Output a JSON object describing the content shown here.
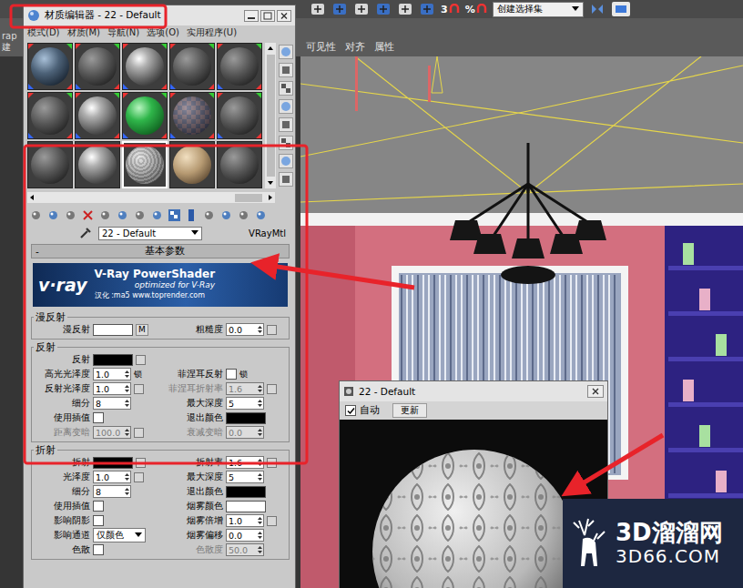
{
  "toolbar": {
    "labels": [
      "3",
      "%"
    ],
    "selection_set": "创建选择集"
  },
  "left_edge": [
    "rap",
    "建"
  ],
  "ribbon_tabs": [
    {
      "label": "可见性",
      "selected": false
    },
    {
      "label": "对齐",
      "selected": false
    },
    {
      "label": "属性",
      "selected": false
    }
  ],
  "material_editor": {
    "title": "材质编辑器 - 22 - Default",
    "menu": [
      "模式(D)",
      "材质(M)",
      "导航(N)",
      "选项(O)",
      "实用程序(U)"
    ],
    "slots": [
      {
        "kind": "glass",
        "selected": false,
        "assigned": true
      },
      {
        "kind": "plain",
        "selected": false,
        "assigned": true
      },
      {
        "kind": "shiny",
        "selected": false,
        "assigned": true
      },
      {
        "kind": "plain",
        "selected": false,
        "assigned": true
      },
      {
        "kind": "plain",
        "selected": false,
        "assigned": true
      },
      {
        "kind": "plain",
        "selected": false,
        "assigned": true
      },
      {
        "kind": "shiny",
        "selected": false,
        "assigned": true
      },
      {
        "kind": "green",
        "selected": false,
        "assigned": true
      },
      {
        "kind": "checker",
        "selected": false,
        "assigned": true
      },
      {
        "kind": "plain",
        "selected": false,
        "assigned": true
      },
      {
        "kind": "plain",
        "selected": false,
        "assigned": false
      },
      {
        "kind": "shiny",
        "selected": false,
        "assigned": false
      },
      {
        "kind": "stone",
        "selected": true,
        "assigned": false
      },
      {
        "kind": "sand",
        "selected": false,
        "assigned": false
      },
      {
        "kind": "plain",
        "selected": false,
        "assigned": false
      }
    ],
    "material_name": "22 - Default",
    "material_type": "VRayMtl",
    "rollout": {
      "title": "基本参数",
      "collapse": "-"
    },
    "banner": {
      "logo": "v·ray",
      "title": "V-Ray PowerShader",
      "subtitle": "optimized for V-Ray",
      "credit": "汉化 :ma5 www.toprender.com"
    },
    "groups": [
      {
        "title": "漫反射",
        "rows": [
          [
            {
              "kind": "swatch",
              "label": "漫反射",
              "color": "#ffffff",
              "map": "M",
              "disabled": false
            },
            {
              "kind": "spinner",
              "label": "粗糙度",
              "value": "0.0",
              "map_slot": true,
              "disabled": false
            }
          ]
        ]
      },
      {
        "title": "反射",
        "rows": [
          [
            {
              "kind": "swatch",
              "label": "反射",
              "color": "#000000",
              "map_slot": true,
              "disabled": false
            }
          ],
          [
            {
              "kind": "spinner",
              "label": "高光光泽度",
              "value": "1.0",
              "lock": "锁",
              "disabled": false
            },
            {
              "kind": "checkbox",
              "label": "菲涅耳反射",
              "checked": false,
              "lock": "锁",
              "disabled": false
            }
          ],
          [
            {
              "kind": "spinner",
              "label": "反射光泽度",
              "value": "1.0",
              "map_slot": true,
              "disabled": false
            },
            {
              "kind": "spinner",
              "label": "菲涅耳折射率",
              "value": "1.6",
              "map_slot": true,
              "disabled": true
            }
          ],
          [
            {
              "kind": "spinner",
              "label": "细分",
              "value": "8",
              "disabled": false
            },
            {
              "kind": "spinner",
              "label": "最大深度",
              "value": "5",
              "disabled": false
            }
          ],
          [
            {
              "kind": "checkbox",
              "label": "使用插值",
              "checked": false,
              "disabled": false
            },
            {
              "kind": "swatch",
              "label": "退出颜色",
              "color": "#000000",
              "disabled": false
            }
          ],
          [
            {
              "kind": "spinner",
              "label": "距离变暗",
              "value": "100.0",
              "map_slot": true,
              "disabled": true
            },
            {
              "kind": "spinner",
              "label": "衰减变暗",
              "value": "0.0",
              "disabled": true
            }
          ]
        ]
      },
      {
        "title": "折射",
        "rows": [
          [
            {
              "kind": "swatch",
              "label": "折射",
              "color": "#000000",
              "map_slot": true,
              "disabled": false
            },
            {
              "kind": "spinner",
              "label": "折射率",
              "value": "1.6",
              "map_slot": true,
              "disabled": false
            }
          ],
          [
            {
              "kind": "spinner",
              "label": "光泽度",
              "value": "1.0",
              "map_slot": true,
              "disabled": false
            },
            {
              "kind": "spinner",
              "label": "最大深度",
              "value": "5",
              "disabled": false
            }
          ],
          [
            {
              "kind": "spinner",
              "label": "细分",
              "value": "8",
              "disabled": false
            },
            {
              "kind": "swatch",
              "label": "退出颜色",
              "color": "#000000",
              "disabled": false
            }
          ],
          [
            {
              "kind": "checkbox",
              "label": "使用插值",
              "checked": false,
              "disabled": false
            },
            {
              "kind": "swatch",
              "label": "烟雾颜色",
              "color": "#ffffff",
              "disabled": false
            }
          ],
          [
            {
              "kind": "checkbox",
              "label": "影响阴影",
              "checked": false,
              "disabled": false
            },
            {
              "kind": "spinner",
              "label": "烟雾倍增",
              "value": "1.0",
              "map_slot": true,
              "disabled": false
            }
          ],
          [
            {
              "kind": "dropdown",
              "label": "影响通道",
              "value": "仅颜色",
              "disabled": false
            },
            {
              "kind": "spinner",
              "label": "烟雾偏移",
              "value": "0.0",
              "disabled": false
            }
          ],
          [
            {
              "kind": "checkbox",
              "label": "色散",
              "checked": false,
              "disabled": false
            },
            {
              "kind": "spinner",
              "label": "色散度",
              "value": "50.0",
              "disabled": true
            }
          ]
        ]
      }
    ]
  },
  "preview": {
    "title": "22 - Default",
    "auto": {
      "label": "自动",
      "checked": true
    },
    "update": "更新"
  },
  "watermark": {
    "name": "3D溜溜网",
    "url": "3D66.COM"
  }
}
